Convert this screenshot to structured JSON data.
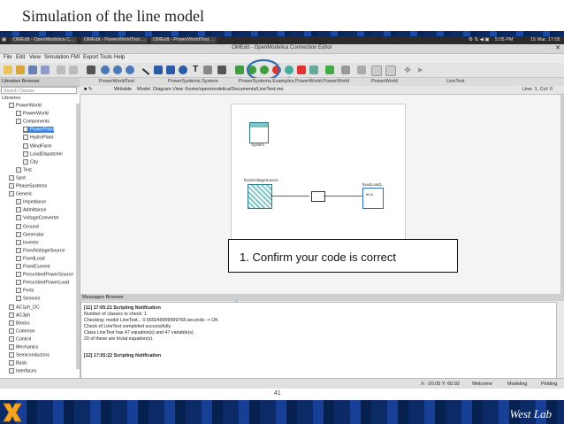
{
  "slide": {
    "title": "Simulation of the line model",
    "page_number": "41",
    "footer_text": "West Lab",
    "callout_text": "1.  Confirm your code is correct"
  },
  "system_bar": {
    "tasks": [
      "OMEdit - OpenModelica C...",
      "OMEdit - PowerWorldTest ...",
      "OMEdit - PowerWorldTest ..."
    ],
    "time": "5:05 PM",
    "date": "15 Mar, 17:05"
  },
  "window": {
    "title": "OMEdit - OpenModelica Connection Editor"
  },
  "menu": [
    "File",
    "Edit",
    "View",
    "Simulation",
    "FMI",
    "Export",
    "Tools",
    "Help"
  ],
  "toolbar": {
    "icons": [
      "new-icon",
      "open-icon",
      "save-icon",
      "save-as-icon",
      "undo-icon",
      "redo-icon",
      "grid-icon",
      "zoom-in-icon",
      "zoom-out-icon",
      "zoom-reset-icon",
      "line-icon",
      "polygon-icon",
      "rectangle-icon",
      "ellipse-icon",
      "text-icon",
      "bitmap-icon",
      "connect-icon",
      "check-model-icon",
      "check-all-icon",
      "instantiate-icon",
      "simulate-icon",
      "simulation-setup-icon",
      "export-icon",
      "plot-icon",
      "diff-icon",
      "reset-icon"
    ],
    "highlight_color": "#2f6fb0"
  },
  "tabs": [
    "PowerWorldTest",
    "PowerSystems.System",
    "PowerSystems.Examples.PowerWorld.PowerWorld",
    "PowerWorld",
    "LineTest"
  ],
  "libraries": {
    "header": "Libraries Browser",
    "search_placeholder": "Search Classes",
    "title": "Libraries",
    "items": [
      {
        "label": "PowerWorld",
        "indent": 1
      },
      {
        "label": "PowerWorld",
        "indent": 2
      },
      {
        "label": "Components",
        "indent": 2
      },
      {
        "label": "PowerPlant",
        "indent": 3,
        "selected": true
      },
      {
        "label": "HydroPlant",
        "indent": 3
      },
      {
        "label": "WindFarm",
        "indent": 3
      },
      {
        "label": "LoadDispatcher",
        "indent": 3
      },
      {
        "label": "City",
        "indent": 3
      },
      {
        "label": "Test",
        "indent": 2
      },
      {
        "label": "Spot",
        "indent": 1
      },
      {
        "label": "PhaseSystems",
        "indent": 1
      },
      {
        "label": "Generic",
        "indent": 1
      },
      {
        "label": "Impedance",
        "indent": 2
      },
      {
        "label": "Admittance",
        "indent": 2
      },
      {
        "label": "VoltageConverter",
        "indent": 2
      },
      {
        "label": "Ground",
        "indent": 2
      },
      {
        "label": "Generator",
        "indent": 2
      },
      {
        "label": "Inverter",
        "indent": 2
      },
      {
        "label": "FixedVoltageSource",
        "indent": 2
      },
      {
        "label": "FixedLoad",
        "indent": 2
      },
      {
        "label": "FixedCurrent",
        "indent": 2
      },
      {
        "label": "PrescribedPowerSource",
        "indent": 2
      },
      {
        "label": "PrescribedPowerLoad",
        "indent": 2
      },
      {
        "label": "Ports",
        "indent": 2
      },
      {
        "label": "Sensors",
        "indent": 2
      },
      {
        "label": "AC1ph_DC",
        "indent": 1
      },
      {
        "label": "AC3ph",
        "indent": 1
      },
      {
        "label": "Blocks",
        "indent": 1
      },
      {
        "label": "Common",
        "indent": 1
      },
      {
        "label": "Control",
        "indent": 1
      },
      {
        "label": "Mechanics",
        "indent": 1
      },
      {
        "label": "Semiconductors",
        "indent": 1
      },
      {
        "label": "Basic",
        "indent": 1
      },
      {
        "label": "Interfaces",
        "indent": 1
      }
    ]
  },
  "model_bar": {
    "writable": "Writable",
    "model": "Model",
    "view": "Diagram View",
    "path": "/home/openmodelica/Documents/LineTest.mo",
    "position": "Line: 1, Col: 0"
  },
  "diagram": {
    "blocks": [
      {
        "name": "system",
        "label": "System"
      },
      {
        "name": "fixedVoltageSource",
        "label": "fixedVoltageSource"
      },
      {
        "name": "line",
        "label": ""
      },
      {
        "name": "fixedLoad",
        "label": "fixedLoad1",
        "value": "60 A"
      }
    ]
  },
  "messages": {
    "header": "Messages Browser",
    "lines": [
      "[11] 17:05:21 Scripting Notification",
      "Number of classes to check: 1",
      "Checking: model LineTest... 0.669249999999768 seconds -> OK",
      "     Check of LineTest completed successfully.",
      "     Class LineTest has 47 equation(s) and 47 variable(s).",
      "     20 of these are trivial equation(s).",
      "",
      "[12] 17:05:22 Scripting Notification"
    ]
  },
  "status_bar": {
    "coords": "X: -20.05   Y: 60.92",
    "welcome": "Welcome",
    "modeling": "Modeling",
    "plotting": "Plotting"
  }
}
